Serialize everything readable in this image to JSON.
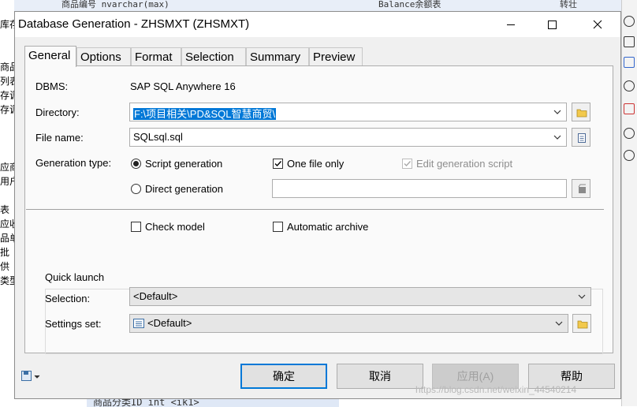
{
  "background": {
    "left_column": [
      "库存",
      "商品",
      "列表",
      "存调",
      "存调",
      "应商",
      "用户",
      "表",
      "应收",
      "品单",
      "批",
      "供",
      "类型"
    ],
    "top_left_text": "商品编号  nvarchar(max)",
    "top_right_text": "Balance余额表",
    "top_far_right": "转壮",
    "bottom_text": "商品分类ID      int          <ik1>"
  },
  "window": {
    "title": "Database Generation - ZHSMXT (ZHSMXT)",
    "minimize_icon": "minimize-icon",
    "maximize_icon": "maximize-icon",
    "close_icon": "close-icon"
  },
  "tabs": [
    {
      "label": "General",
      "active": true
    },
    {
      "label": "Options",
      "active": false
    },
    {
      "label": "Format",
      "active": false
    },
    {
      "label": "Selection",
      "active": false
    },
    {
      "label": "Summary",
      "active": false
    },
    {
      "label": "Preview",
      "active": false
    }
  ],
  "general": {
    "dbms_label": "DBMS:",
    "dbms_value": "SAP SQL Anywhere 16",
    "directory_label": "Directory:",
    "directory_value": "F:\\项目相关\\PD&SQL智慧商贸\\",
    "filename_label": "File name:",
    "filename_value": "SQLsql.sql",
    "gentype_label": "Generation type:",
    "script_generation": "Script generation",
    "direct_generation": "Direct generation",
    "one_file_only": "One file only",
    "edit_generation_script": "Edit generation script",
    "check_model": "Check model",
    "automatic_archive": "Automatic archive",
    "quick_launch_title": "Quick launch",
    "selection_label": "Selection:",
    "selection_value": "<Default>",
    "settings_label": "Settings set:",
    "settings_value": "<Default>"
  },
  "state": {
    "script_generation_selected": true,
    "one_file_only_checked": true,
    "edit_generation_script_checked": true,
    "check_model_checked": false,
    "automatic_archive_checked": false
  },
  "buttons": {
    "ok": "确定",
    "cancel": "取消",
    "apply": "应用(A)",
    "help": "帮助"
  },
  "watermark": "https://blog.csdn.net/weixin_44540214",
  "colors": {
    "selection": "#0078d7",
    "dialog_bg": "#f0f0f0",
    "panel_bg": "#fafafa"
  }
}
